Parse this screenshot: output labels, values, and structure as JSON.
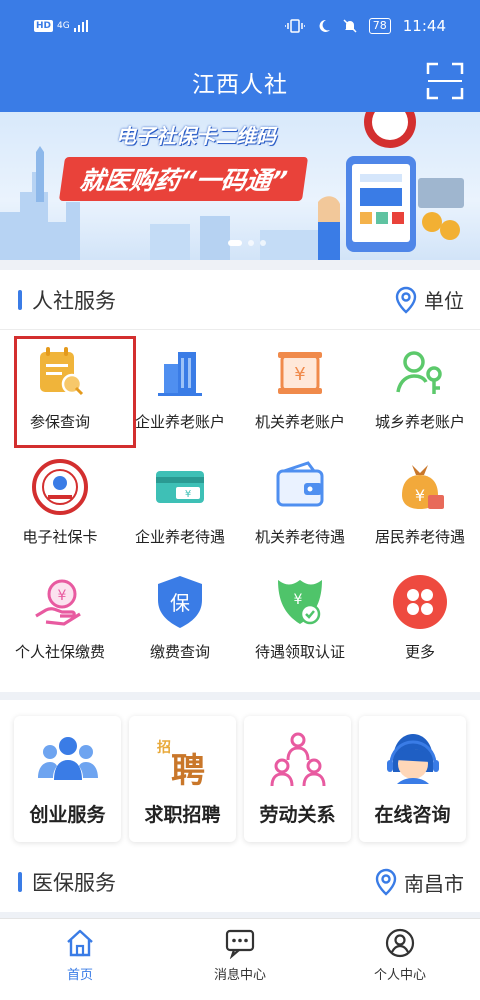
{
  "status_bar": {
    "network": "4G",
    "battery": "78",
    "time": "11:44"
  },
  "app": {
    "title": "江西人社"
  },
  "banner": {
    "line1": "电子社保卡二维码",
    "line2": "就医购药“一码通”"
  },
  "hr_services": {
    "title": "人社服务",
    "location_label": "单位",
    "items": [
      {
        "label": "参保查询",
        "icon": "insurance-query-icon"
      },
      {
        "label": "企业养老账户",
        "icon": "enterprise-pension-account-icon"
      },
      {
        "label": "机关养老账户",
        "icon": "government-pension-account-icon"
      },
      {
        "label": "城乡养老账户",
        "icon": "urban-rural-pension-account-icon"
      },
      {
        "label": "电子社保卡",
        "icon": "social-security-card-icon"
      },
      {
        "label": "企业养老待遇",
        "icon": "enterprise-pension-benefit-icon"
      },
      {
        "label": "机关养老待遇",
        "icon": "government-pension-benefit-icon"
      },
      {
        "label": "居民养老待遇",
        "icon": "resident-pension-benefit-icon"
      },
      {
        "label": "个人社保缴费",
        "icon": "personal-payment-icon"
      },
      {
        "label": "缴费查询",
        "icon": "payment-query-icon"
      },
      {
        "label": "待遇领取认证",
        "icon": "benefit-authentication-icon"
      },
      {
        "label": "更多",
        "icon": "more-icon"
      }
    ]
  },
  "quick_links": [
    {
      "label": "创业服务",
      "icon": "entrepreneurship-icon"
    },
    {
      "label": "求职招聘",
      "icon": "job-recruitment-icon"
    },
    {
      "label": "劳动关系",
      "icon": "labor-relations-icon"
    },
    {
      "label": "在线咨询",
      "icon": "online-consultation-icon"
    }
  ],
  "medical_services": {
    "title": "医保服务",
    "location_label": "南昌市"
  },
  "tabbar": [
    {
      "label": "首页",
      "icon": "home-icon",
      "active": true
    },
    {
      "label": "消息中心",
      "icon": "message-icon",
      "active": false
    },
    {
      "label": "个人中心",
      "icon": "profile-icon",
      "active": false
    }
  ],
  "colors": {
    "primary": "#3a7ce6",
    "highlight": "#d32f2f",
    "banner_red": "#e9423a"
  }
}
